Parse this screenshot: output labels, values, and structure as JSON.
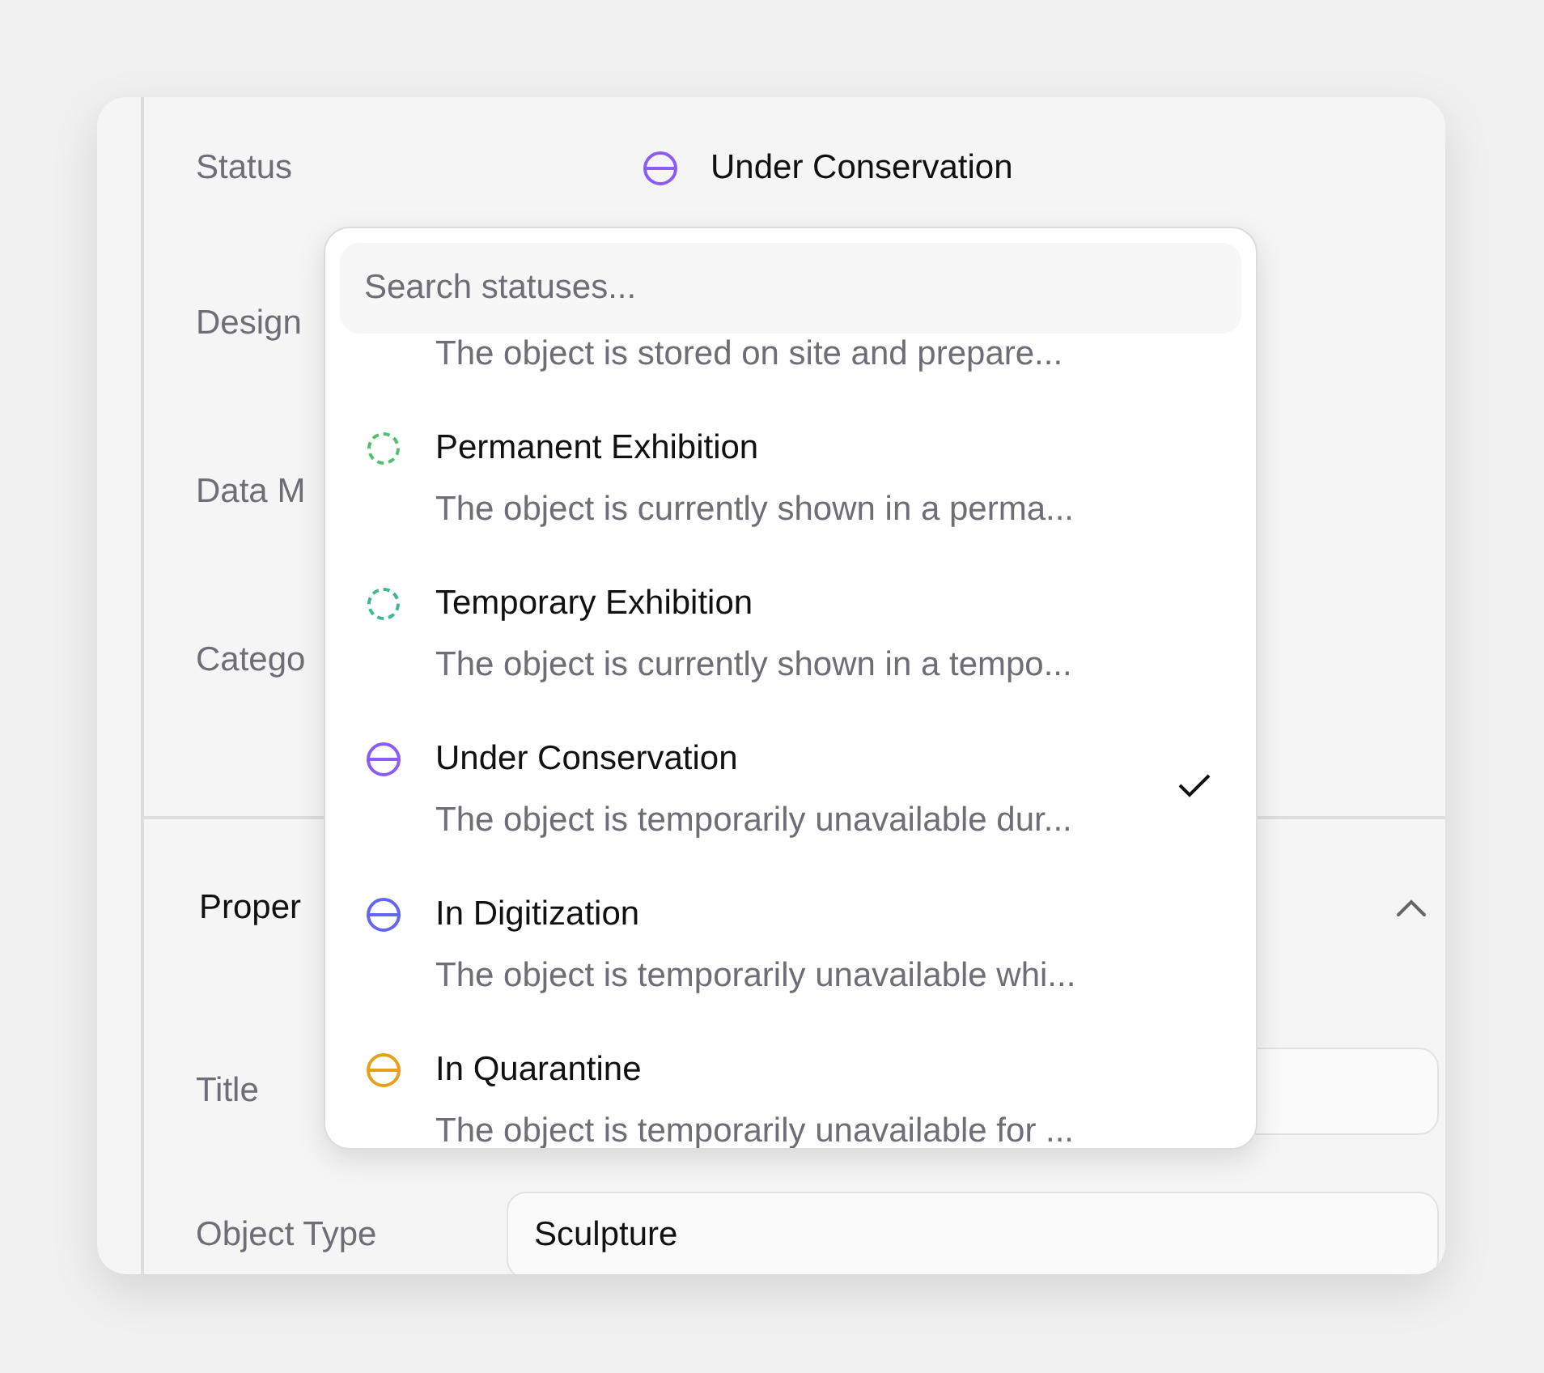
{
  "fields": [
    {
      "label": "Status",
      "kind": "status",
      "value": "Under Conservation",
      "color": "#8b5cf6"
    },
    {
      "label": "Design",
      "kind": "blank"
    },
    {
      "label": "Data M",
      "kind": "blank"
    },
    {
      "label": "Catego",
      "kind": "blank"
    }
  ],
  "section": {
    "title": "Proper",
    "expanded": true,
    "fields": [
      {
        "label": "Title"
      },
      {
        "label": "Object Type",
        "value": "Sculpture"
      }
    ]
  },
  "dropdown": {
    "search": {
      "placeholder": "Search statuses..."
    },
    "options": [
      {
        "kind": "partial",
        "description": "The object is stored on site and prepare...",
        "selected": false
      },
      {
        "kind": "exhibition",
        "name": "Permanent Exhibition",
        "description": "The object is currently shown in a perma...",
        "color": "#4cc26f",
        "selected": false
      },
      {
        "kind": "exhibition",
        "name": "Temporary Exhibition",
        "description": "The object is currently shown in a tempo...",
        "color": "#3dba8c",
        "selected": false
      },
      {
        "kind": "unavailable",
        "name": "Under Conservation",
        "description": "The object is temporarily unavailable dur...",
        "color": "#8b5cf6",
        "selected": true
      },
      {
        "kind": "unavailable",
        "name": "In Digitization",
        "description": "The object is temporarily unavailable whi...",
        "color": "#6366f1",
        "selected": false
      },
      {
        "kind": "unavailable",
        "name": "In Quarantine",
        "description": "The object is temporarily unavailable for ...",
        "color": "#e5a11a",
        "selected": false
      }
    ]
  }
}
